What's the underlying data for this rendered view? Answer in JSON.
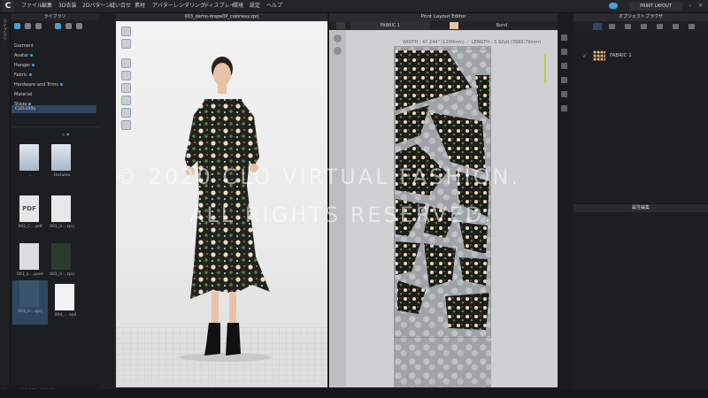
{
  "menu": {
    "logo": "C",
    "items": [
      "ファイル",
      "編集",
      "3D衣装",
      "2Dパターン",
      "縫い合せ",
      "素材",
      "アバター",
      "レンダリング",
      "ディスプレイ",
      "環境",
      "設定",
      "ヘルプ"
    ],
    "mode": "PRINT LAYOUT"
  },
  "library": {
    "side_tab": "ライブラリ",
    "title": "ライブラリ",
    "items": [
      "Garment",
      "Avatar",
      "Hanger",
      "Fabric",
      "Hardware and Trims",
      "Material",
      "Stage",
      "CLO-Utils"
    ],
    "files": [
      "..",
      "textures",
      "002_C....pdf",
      "001_d....zprj",
      "001_a....pose",
      "001_d....zprj",
      "003_d....zprj",
      "004_....ep4"
    ],
    "version": "Version: 4.2.285 (r36040)"
  },
  "view3d": {
    "title": "003_demo-drape0P_colorway.zprj"
  },
  "print_layout": {
    "title": "Print Layout Editor",
    "tab_fabric": "FABRIC 1",
    "tab_bond": "Bond",
    "width_label": "WIDTH : 47.244\" (1200mm) ／ LENGTH : 3.92yd (3583.79mm)"
  },
  "object_browser": {
    "title": "オブジェクトブラウザ",
    "fabric": "FABRIC 1"
  },
  "properties": {
    "title": "属性編集"
  },
  "watermark": {
    "line1": "© 2020 CLO VIRTUAL FASHION.",
    "line2": "ALL RIGHTS RESERVED."
  },
  "colors": {
    "accent": "#3aa3e0",
    "panel": "#1d1e22",
    "selection": "#2e4661"
  }
}
